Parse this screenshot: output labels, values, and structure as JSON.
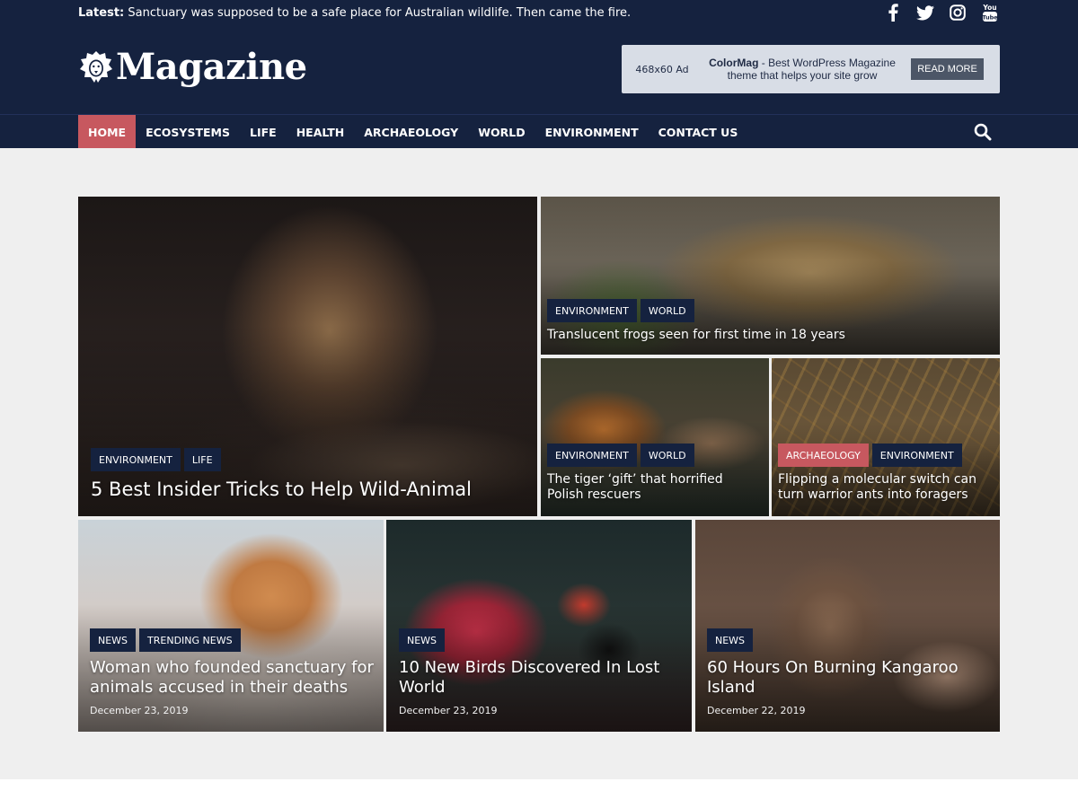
{
  "topbar": {
    "latest_label": "Latest:",
    "latest_text": "Sanctuary was supposed to be a safe place for Australian wildlife. Then came the fire.",
    "socials": [
      "facebook-icon",
      "twitter-icon",
      "instagram-icon",
      "youtube-icon"
    ]
  },
  "brand": {
    "logo_text": "Magazine",
    "logo_icon": "lion-head-icon"
  },
  "ad": {
    "size_label": "468x60 Ad",
    "headline": "ColorMag",
    "text": " - Best WordPress Magazine theme that helps your site grow",
    "button": "READ MORE"
  },
  "nav": {
    "items": [
      "HOME",
      "ECOSYSTEMS",
      "LIFE",
      "HEALTH",
      "ARCHAEOLOGY",
      "WORLD",
      "ENVIRONMENT",
      "CONTACT US"
    ],
    "active": "HOME",
    "search_icon": "search-icon"
  },
  "colors": {
    "header_bg": "#15223f",
    "accent": "#c7585f",
    "page_bg": "#efefef"
  },
  "featured": {
    "lion": {
      "tags": [
        "ENVIRONMENT",
        "LIFE"
      ],
      "title": "5 Best Insider Tricks to Help Wild-Animal"
    },
    "frog": {
      "tags": [
        "ENVIRONMENT",
        "WORLD"
      ],
      "title": "Translucent frogs seen for first time in 18 years"
    },
    "tiger": {
      "tags": [
        "ENVIRONMENT",
        "WORLD"
      ],
      "title": "The tiger ‘gift’ that horrified Polish rescuers"
    },
    "ants": {
      "tags": [
        "ARCHAEOLOGY",
        "ENVIRONMENT"
      ],
      "title": "Flipping a molecular switch can turn warrior ants into foragers"
    }
  },
  "posts": [
    {
      "tags": [
        "NEWS",
        "TRENDING NEWS"
      ],
      "title": "Woman who founded sanctuary for animals accused in their deaths",
      "date": "December 23, 2019"
    },
    {
      "tags": [
        "NEWS"
      ],
      "title": "10 New Birds Discovered In Lost World",
      "date": "December 23, 2019"
    },
    {
      "tags": [
        "NEWS"
      ],
      "title": "60 Hours On Burning Kangaroo Island",
      "date": "December 22, 2019"
    }
  ]
}
